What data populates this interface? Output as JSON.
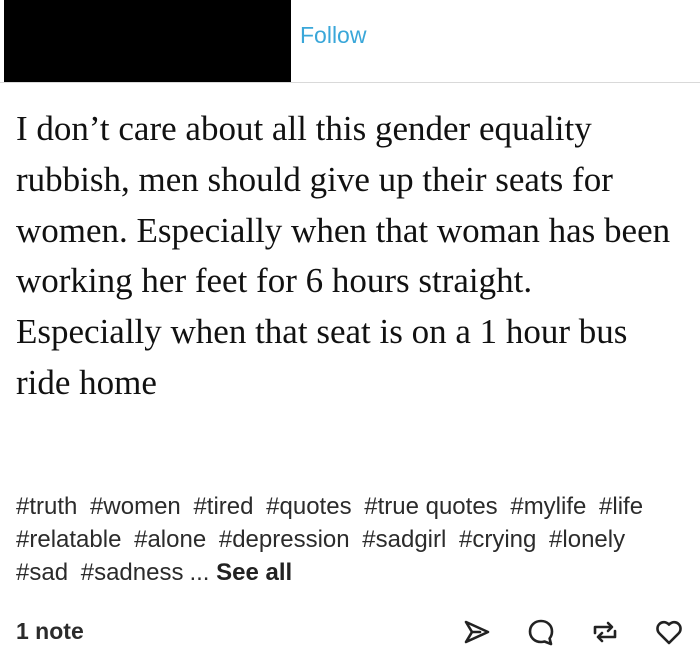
{
  "header": {
    "follow_label": "Follow"
  },
  "post": {
    "text": "I don’t care about all this gender equality rubbish, men should give up their seats for women. Especially when that woman has been working her feet for 6 hours straight. Especially when that seat is on a 1 hour bus ride home"
  },
  "tags": [
    "#truth",
    "#women",
    "#tired",
    "#quotes",
    "#true quotes",
    "#mylife",
    "#life",
    "#relatable",
    "#alone",
    "#depression",
    "#sadgirl",
    "#crying",
    "#lonely",
    "#sad",
    "#sadness"
  ],
  "tags_ellipsis": "...",
  "see_all_label": "See all",
  "footer": {
    "notes_label": "1 note",
    "icons": [
      "share-icon",
      "reply-icon",
      "reblog-icon",
      "like-icon"
    ]
  },
  "colors": {
    "follow_link": "#3aa7d9",
    "text": "#111111",
    "redaction": "#000000"
  }
}
